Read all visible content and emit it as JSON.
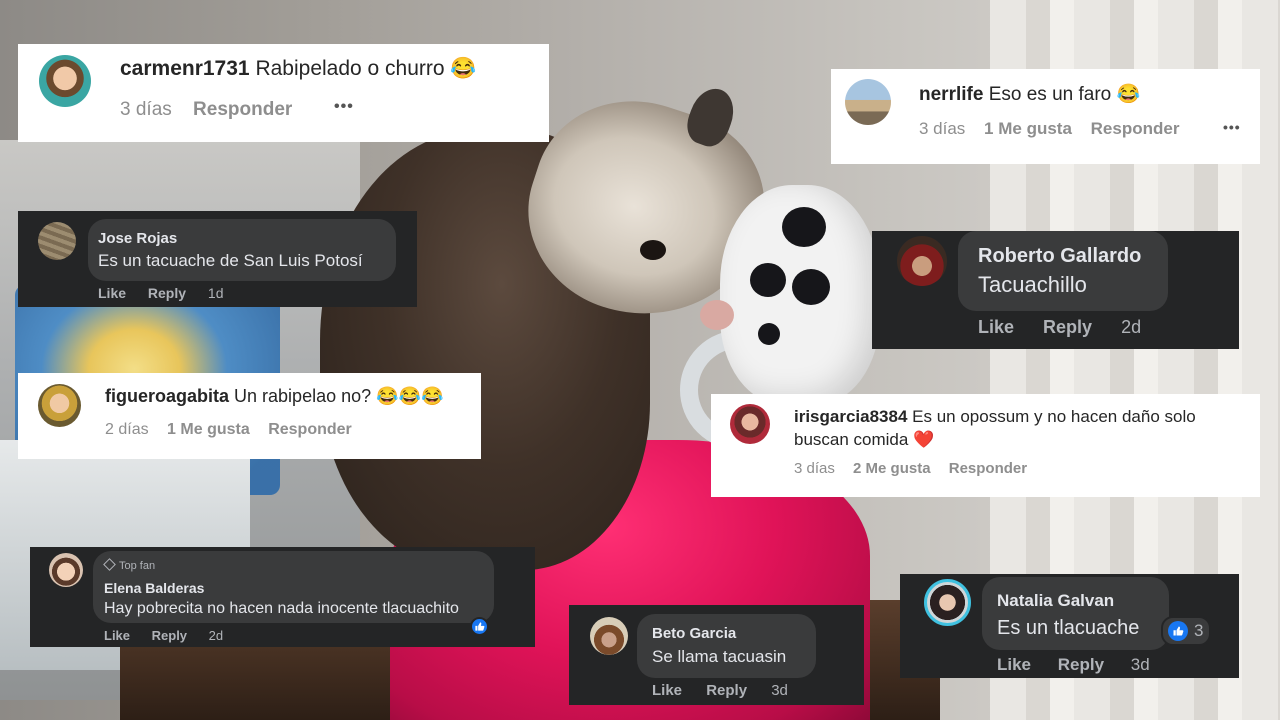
{
  "comments": {
    "c1": {
      "user": "carmenr1731",
      "text": "Rabipelado o churro",
      "emoji": "😂",
      "time": "3 días",
      "reply": "Responder",
      "more": "•••"
    },
    "c2": {
      "user": "nerrlife",
      "text": "Eso es un faro",
      "emoji": "😂",
      "time": "3 días",
      "likes": "1 Me gusta",
      "reply": "Responder",
      "more": "•••"
    },
    "c3": {
      "name": "Jose Rojas",
      "text": "Es un tacuache de San Luis Potosí",
      "like": "Like",
      "reply": "Reply",
      "time": "1d"
    },
    "c4": {
      "name": "Roberto Gallardo",
      "text": "Tacuachillo",
      "like": "Like",
      "reply": "Reply",
      "time": "2d"
    },
    "c5": {
      "user": "figueroagabita",
      "text": "Un rabipelao no?",
      "emoji": "😂😂😂",
      "time": "2 días",
      "likes": "1 Me gusta",
      "reply": "Responder"
    },
    "c6": {
      "user": "irisgarcia8384",
      "text_line1": "Es un opossum y no hacen daño solo",
      "text_line2": "buscan comida",
      "emoji": "❤️",
      "time": "3 días",
      "likes": "2 Me gusta",
      "reply": "Responder"
    },
    "c7": {
      "badge": "Top fan",
      "name": "Elena Balderas",
      "text": "Hay pobrecita no hacen nada inocente tlacuachito",
      "like": "Like",
      "reply": "Reply",
      "time": "2d"
    },
    "c8": {
      "name": "Beto Garcia",
      "text": "Se llama tacuasin",
      "like": "Like",
      "reply": "Reply",
      "time": "3d"
    },
    "c9": {
      "name": "Natalia Galvan",
      "text": "Es un tlacuache",
      "like": "Like",
      "reply": "Reply",
      "time": "3d",
      "reaction_count": "3"
    }
  },
  "colors": {
    "fb_dark": "#242526",
    "fb_bubble": "#3a3b3c",
    "fb_blue": "#1877f2",
    "ig_meta": "#8e8e8e"
  },
  "icons": [
    "avatar",
    "like-thumb-icon",
    "more-dots-icon",
    "top-fan-diamond-icon"
  ]
}
